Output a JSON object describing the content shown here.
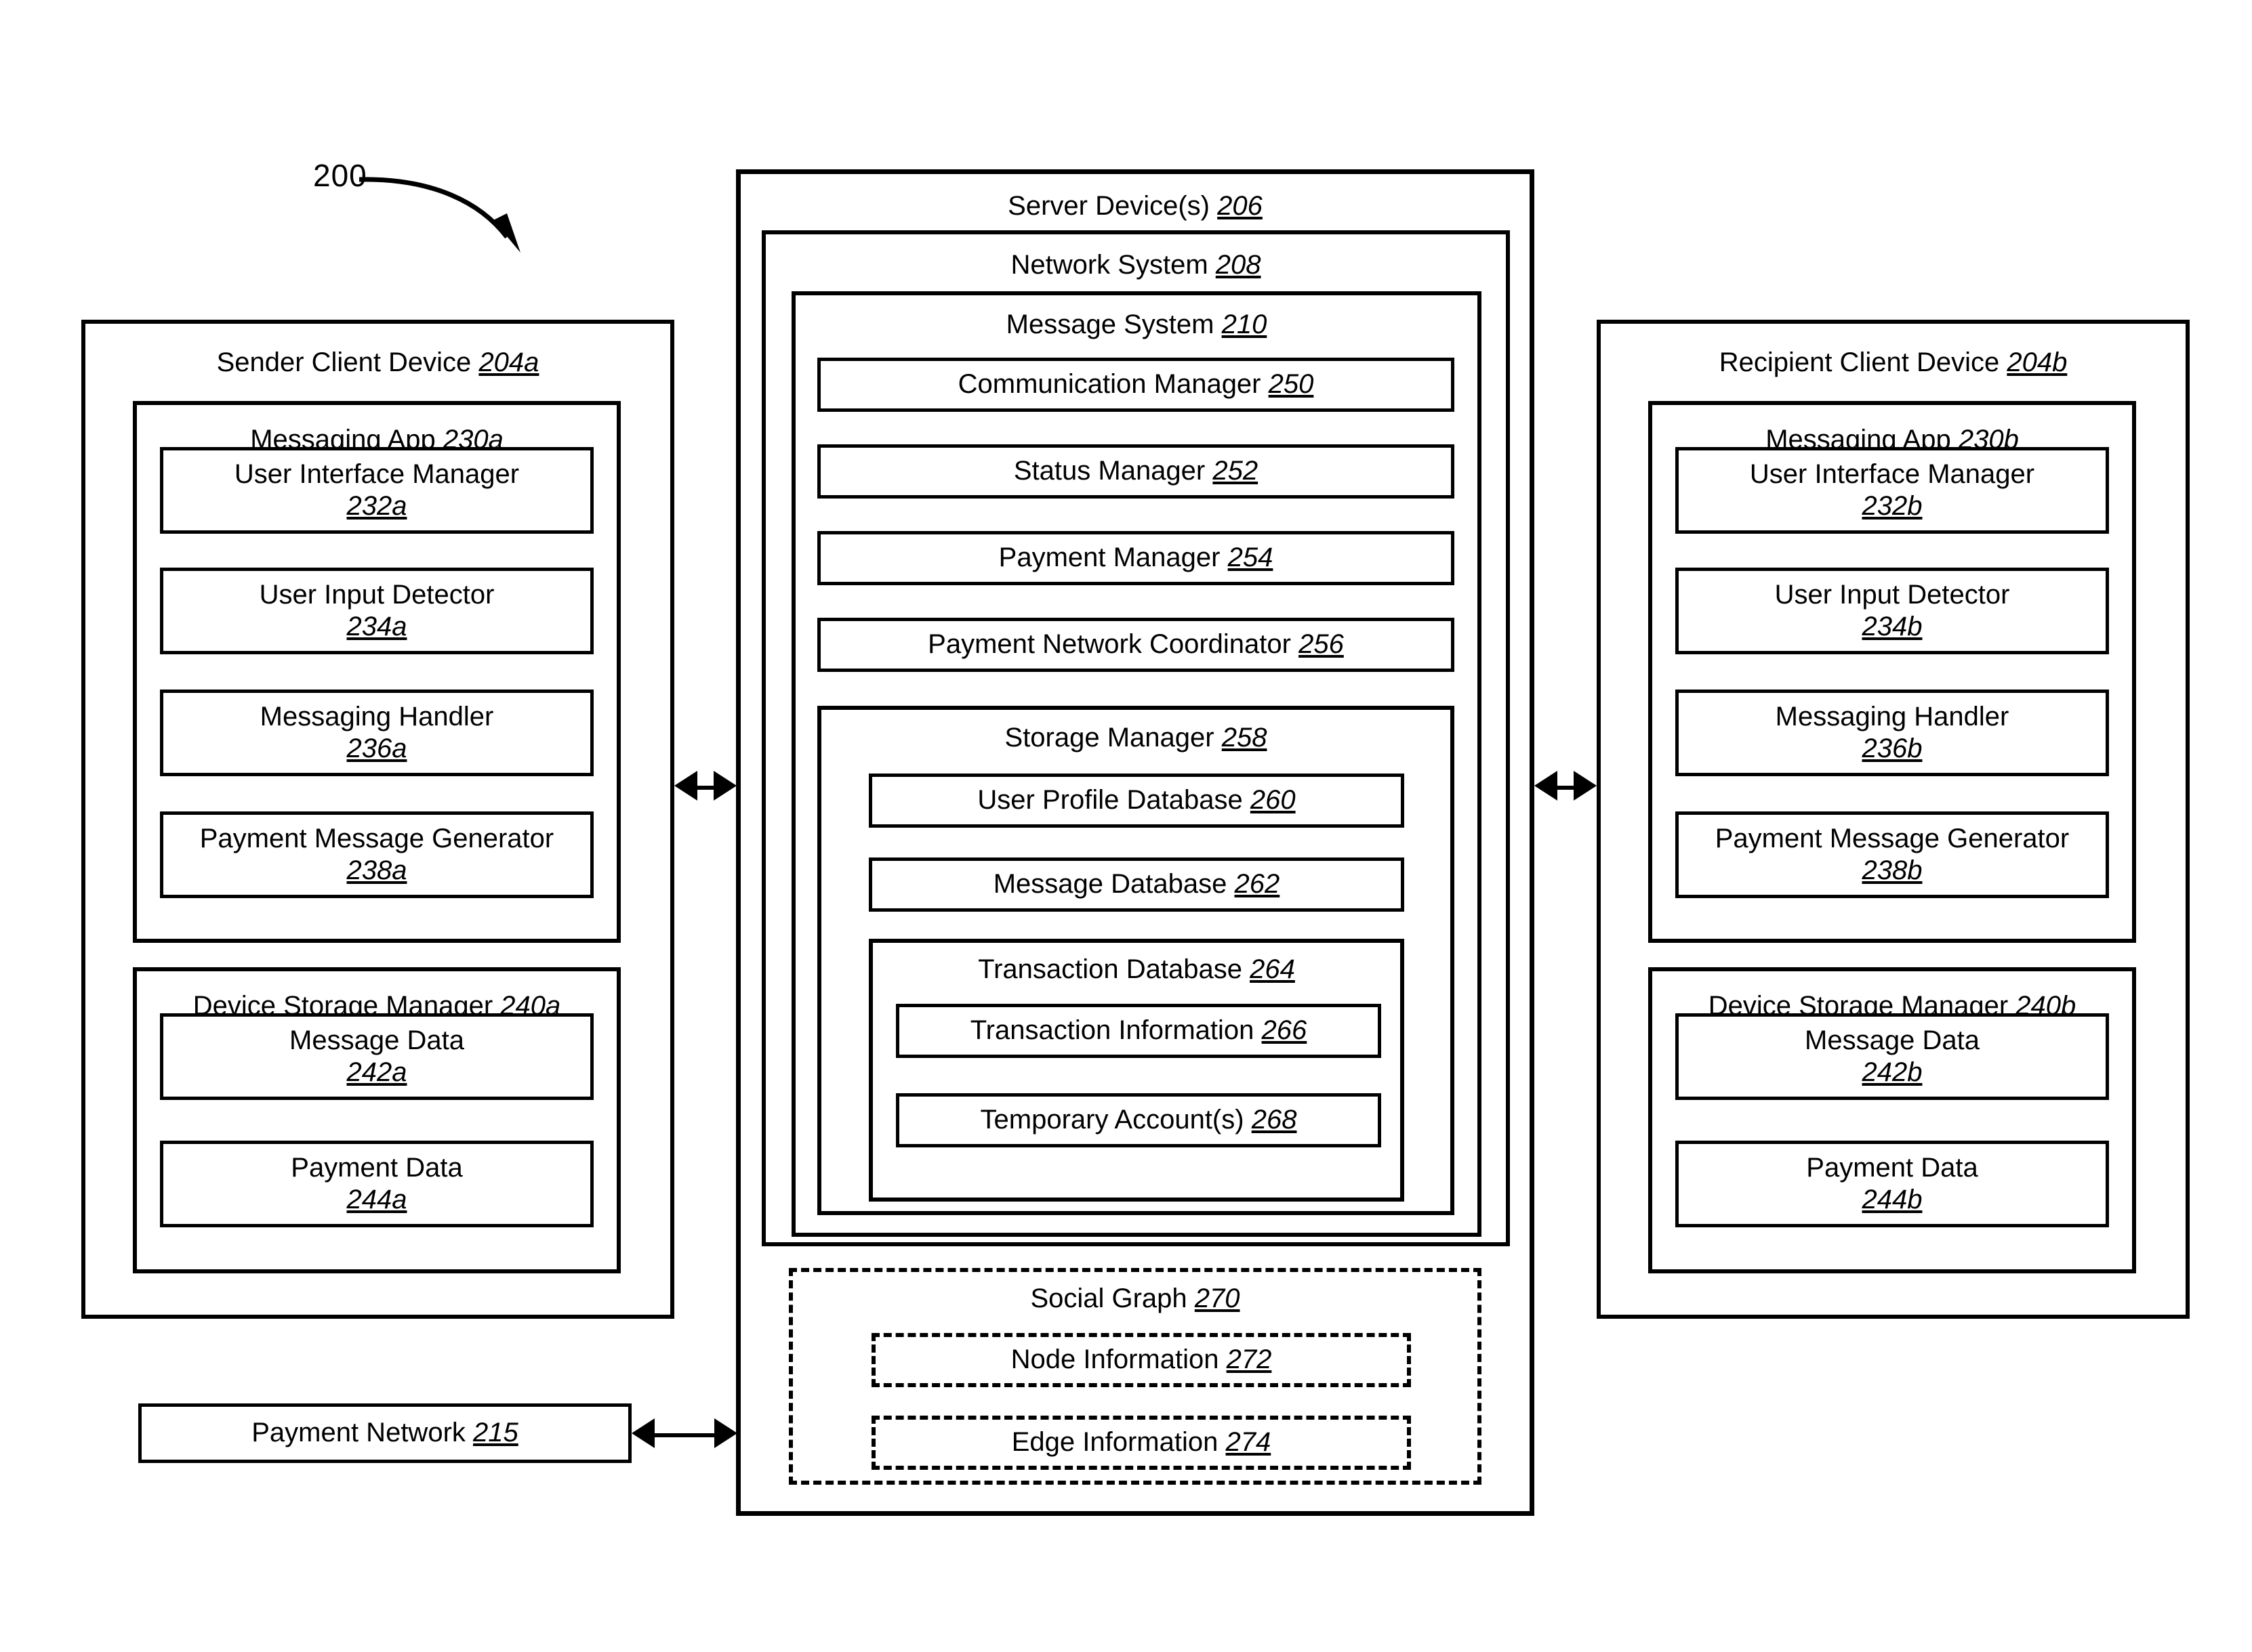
{
  "figure": {
    "callout_number": "200"
  },
  "sender_device": {
    "title": "Sender Client Device",
    "ref": "204a",
    "messaging_app": {
      "title": "Messaging App",
      "ref": "230a",
      "modules": [
        {
          "label": "User Interface Manager",
          "ref": "232a"
        },
        {
          "label": "User Input Detector",
          "ref": "234a"
        },
        {
          "label": "Messaging Handler",
          "ref": "236a"
        },
        {
          "label": "Payment Message Generator",
          "ref": "238a"
        }
      ]
    },
    "storage_manager": {
      "title": "Device Storage Manager",
      "ref": "240a",
      "modules": [
        {
          "label": "Message Data",
          "ref": "242a"
        },
        {
          "label": "Payment Data",
          "ref": "244a"
        }
      ]
    }
  },
  "payment_network": {
    "label": "Payment Network",
    "ref": "215"
  },
  "server": {
    "title": "Server Device(s)",
    "ref": "206",
    "network_system": {
      "title": "Network System",
      "ref": "208",
      "message_system": {
        "title": "Message System",
        "ref": "210",
        "managers": [
          {
            "label": "Communication Manager",
            "ref": "250"
          },
          {
            "label": "Status Manager",
            "ref": "252"
          },
          {
            "label": "Payment Manager",
            "ref": "254"
          },
          {
            "label": "Payment Network Coordinator",
            "ref": "256"
          }
        ],
        "storage_manager": {
          "title": "Storage Manager",
          "ref": "258",
          "databases": [
            {
              "label": "User Profile Database",
              "ref": "260"
            },
            {
              "label": "Message Database",
              "ref": "262"
            }
          ],
          "transaction_database": {
            "title": "Transaction Database",
            "ref": "264",
            "items": [
              {
                "label": "Transaction Information",
                "ref": "266"
              },
              {
                "label": "Temporary Account(s)",
                "ref": "268"
              }
            ]
          }
        }
      }
    },
    "social_graph": {
      "title": "Social Graph",
      "ref": "270",
      "items": [
        {
          "label": "Node Information",
          "ref": "272"
        },
        {
          "label": "Edge Information",
          "ref": "274"
        }
      ]
    }
  },
  "recipient_device": {
    "title": "Recipient Client Device",
    "ref": "204b",
    "messaging_app": {
      "title": "Messaging App",
      "ref": "230b",
      "modules": [
        {
          "label": "User Interface Manager",
          "ref": "232b"
        },
        {
          "label": "User Input Detector",
          "ref": "234b"
        },
        {
          "label": "Messaging Handler",
          "ref": "236b"
        },
        {
          "label": "Payment Message Generator",
          "ref": "238b"
        }
      ]
    },
    "storage_manager": {
      "title": "Device Storage Manager",
      "ref": "240b",
      "modules": [
        {
          "label": "Message Data",
          "ref": "242b"
        },
        {
          "label": "Payment Data",
          "ref": "244b"
        }
      ]
    }
  },
  "connections": [
    {
      "name": "sender-to-server",
      "type": "bidirectional"
    },
    {
      "name": "server-to-recipient",
      "type": "bidirectional"
    },
    {
      "name": "payment-network-to-server",
      "type": "bidirectional"
    }
  ],
  "colors": {
    "stroke": "#000000",
    "background": "#ffffff"
  }
}
